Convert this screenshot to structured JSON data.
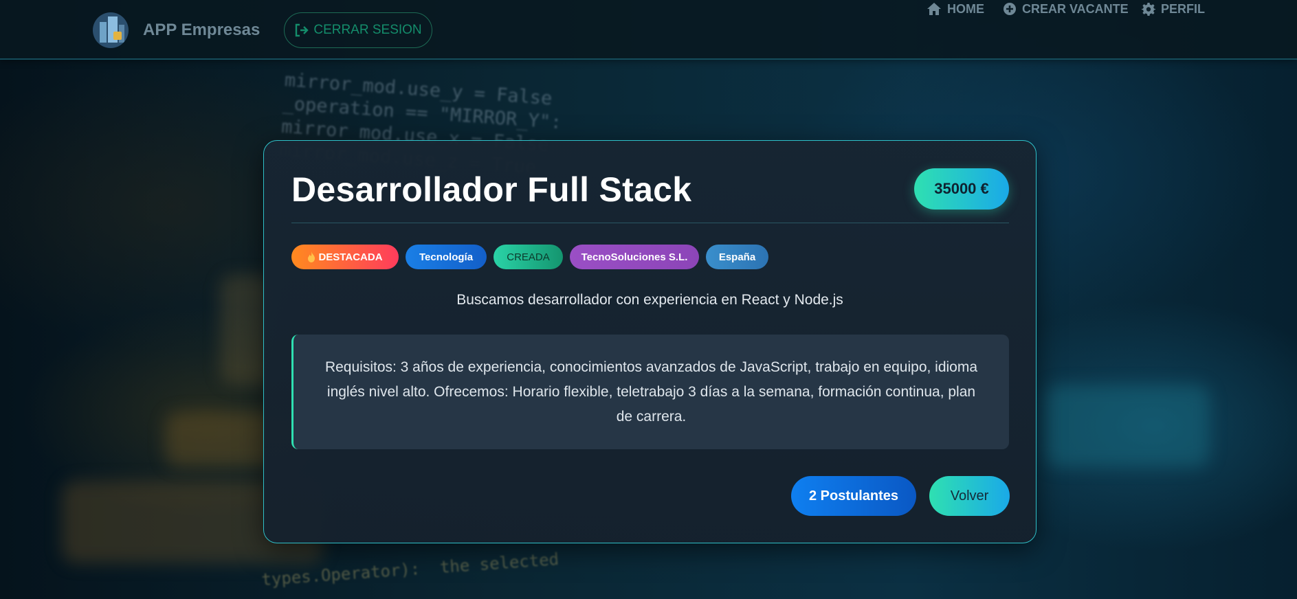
{
  "navbar": {
    "brand": "APP Empresas",
    "logout_label": "CERRAR SESION",
    "menu": [
      {
        "label": "HOME",
        "icon": "home-icon"
      },
      {
        "label": "CREAR VACANTE",
        "icon": "plus-circle-icon"
      },
      {
        "label": "PERFIL",
        "icon": "gear-icon"
      }
    ]
  },
  "job": {
    "title": "Desarrollador Full Stack",
    "salary": "35000 €",
    "tags": {
      "featured": "DESTACADA",
      "category": "Tecnología",
      "status": "CREADA",
      "company": "TecnoSoluciones S.L.",
      "country": "España"
    },
    "description": "Buscamos desarrollador con experiencia en React y Node.js",
    "requirements": "Requisitos: 3 años de experiencia, conocimientos avanzados de JavaScript, trabajo en equipo, idioma inglés nivel alto. Ofrecemos: Horario flexible, teletrabajo 3 días a la semana, formación continua, plan de carrera.",
    "applicants_label": "2 Postulantes",
    "back_label": "Volver"
  },
  "colors": {
    "accent": "#2fe0b1",
    "primary": "#0f7ff0",
    "card_bg": "#172532"
  }
}
